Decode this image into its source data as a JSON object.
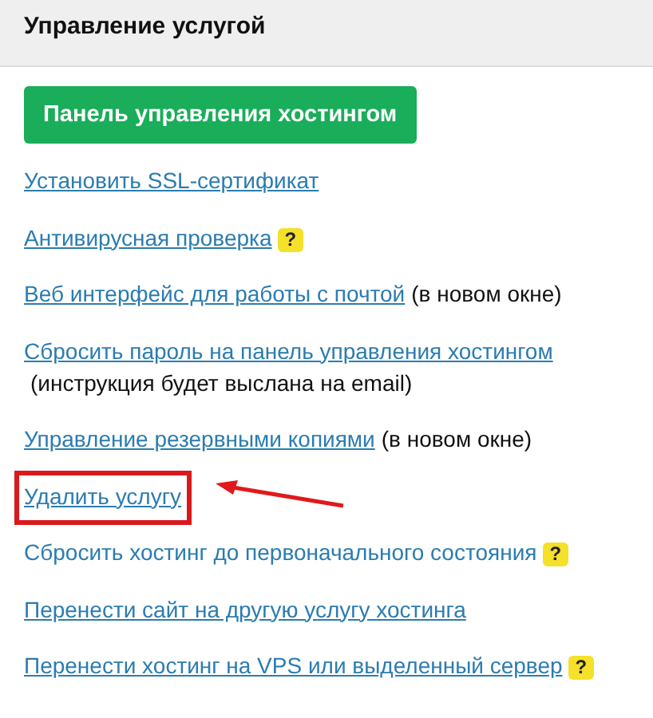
{
  "panel": {
    "title": "Управление услугой"
  },
  "primary_button": "Панель управления хостингом",
  "actions": [
    {
      "text": "Установить SSL-сертификат",
      "underlined": true,
      "highlighted": false
    },
    {
      "text": "Антивирусная проверка",
      "underlined": true,
      "highlighted": false,
      "help": "?"
    },
    {
      "text": "Веб интерфейс для работы с почтой",
      "underlined": true,
      "highlighted": false,
      "note": "(в новом окне)"
    },
    {
      "text": "Сбросить пароль на панель управления хостингом",
      "underlined": true,
      "highlighted": false,
      "note": "(инструкция будет выслана на email)"
    },
    {
      "text": "Управление резервными копиями",
      "underlined": true,
      "highlighted": false,
      "note": "(в новом окне)"
    },
    {
      "text": "Удалить услугу",
      "underlined": true,
      "highlighted": true
    },
    {
      "text": "Сбросить хостинг до первоначального состояния",
      "underlined": false,
      "highlighted": false,
      "help": "?"
    },
    {
      "text": "Перенести сайт на другую услугу хостинга",
      "underlined": true,
      "highlighted": false
    },
    {
      "text": "Перенести хостинг на VPS или выделенный сервер",
      "underlined": true,
      "highlighted": false,
      "help": "?"
    }
  ]
}
